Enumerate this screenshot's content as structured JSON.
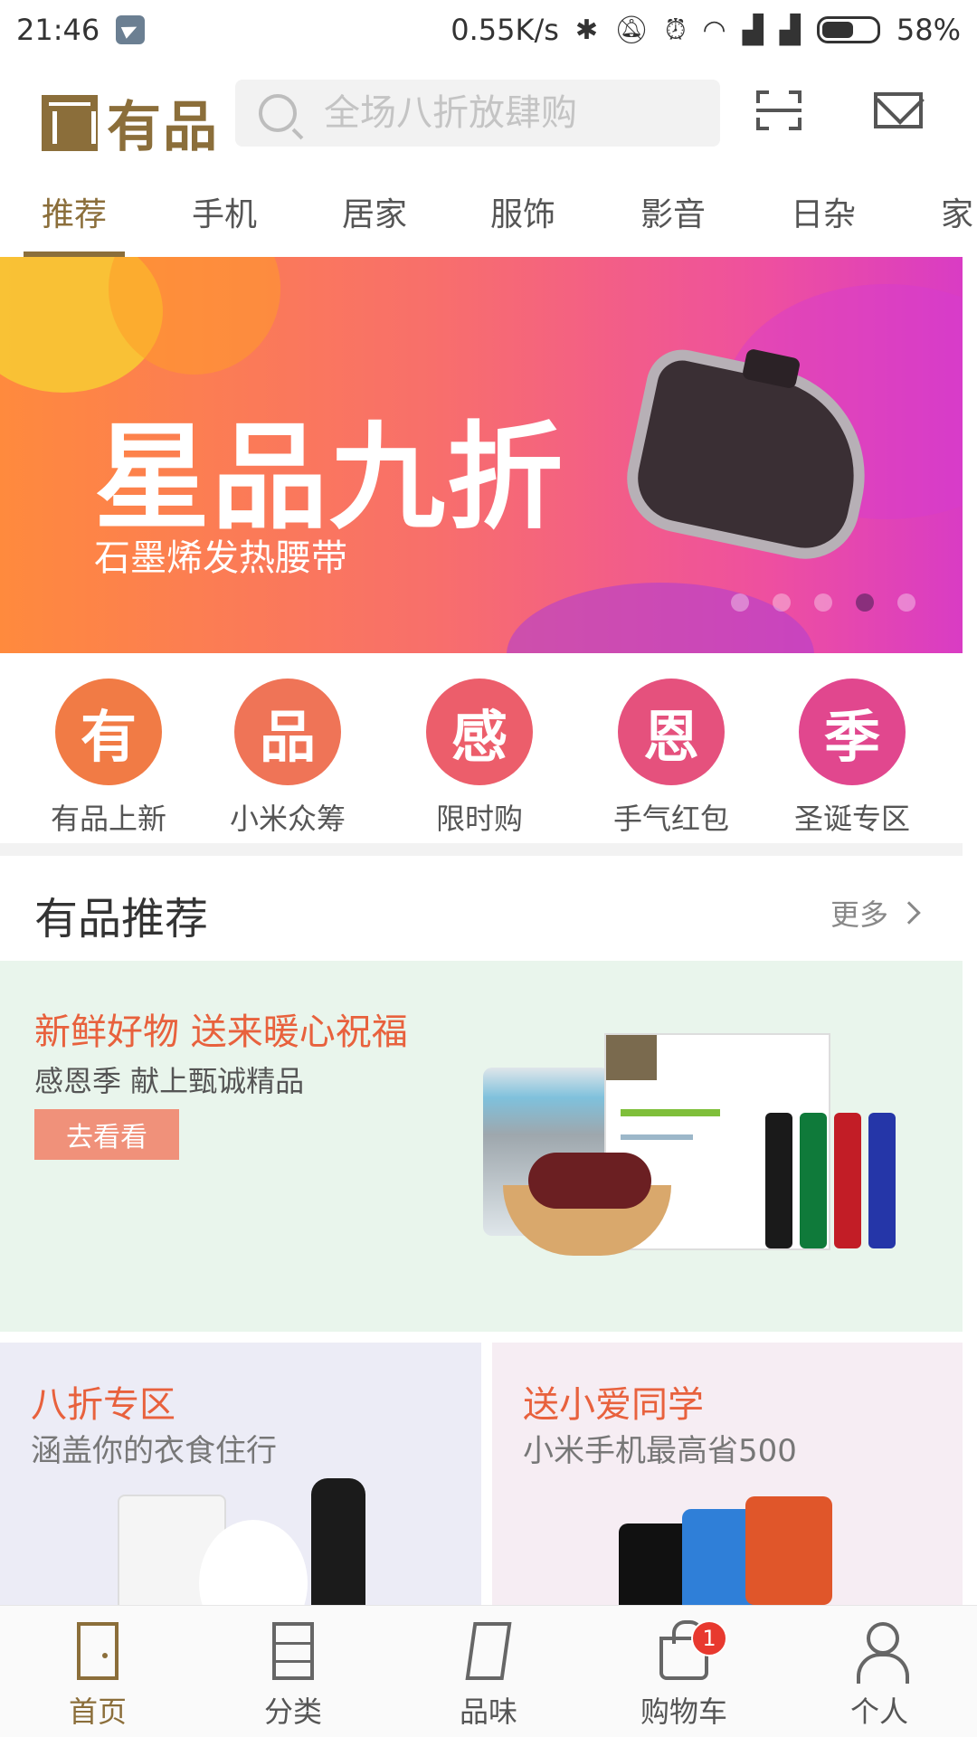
{
  "status_bar": {
    "time": "21:46",
    "network_speed": "0.55K/s",
    "battery_percent": "58%",
    "icons": [
      "telegram-icon",
      "bluetooth-icon",
      "mute-icon",
      "alarm-icon",
      "wifi-icon",
      "signal-icon",
      "signal-icon",
      "battery-icon"
    ]
  },
  "header": {
    "logo_text": "有品",
    "search_placeholder": "全场八折放肆购",
    "icons": [
      "scan-icon",
      "mail-icon"
    ]
  },
  "tabs": [
    {
      "label": "推荐",
      "active": true
    },
    {
      "label": "手机"
    },
    {
      "label": "居家"
    },
    {
      "label": "服饰"
    },
    {
      "label": "影音"
    },
    {
      "label": "日杂"
    },
    {
      "label": "家"
    }
  ],
  "banner": {
    "title": "星品九折",
    "subtitle": "石墨烯发热腰带",
    "dot_count": 5,
    "active_dot_index": 3
  },
  "shortcuts": [
    {
      "glyph": "有",
      "label": "有品上新",
      "color": "#f17b45"
    },
    {
      "glyph": "品",
      "label": "小米众筹",
      "color": "#ef7457"
    },
    {
      "glyph": "感",
      "label": "限时购",
      "color": "#ec5e6b"
    },
    {
      "glyph": "恩",
      "label": "手气红包",
      "color": "#e5517d"
    },
    {
      "glyph": "季",
      "label": "圣诞专区",
      "color": "#e1478e"
    }
  ],
  "section": {
    "title": "有品推荐",
    "more_label": "更多"
  },
  "promo": {
    "title": "新鲜好物 送来暖心祝福",
    "subtitle": "感恩季 献上甄诚精品",
    "button_label": "去看看"
  },
  "cards": [
    {
      "title": "八折专区",
      "subtitle": "涵盖你的衣食住行"
    },
    {
      "title": "送小爱同学",
      "subtitle": "小米手机最高省500"
    }
  ],
  "bottom_nav": [
    {
      "label": "首页",
      "icon": "door-icon",
      "active": true
    },
    {
      "label": "分类",
      "icon": "cabinet-icon"
    },
    {
      "label": "品味",
      "icon": "book-icon"
    },
    {
      "label": "购物车",
      "icon": "shopping-bag-icon",
      "badge": "1"
    },
    {
      "label": "个人",
      "icon": "person-icon"
    }
  ],
  "colors": {
    "brand": "#8b6e3a",
    "accent_orange": "#e8613d",
    "badge_red": "#e8392f"
  }
}
